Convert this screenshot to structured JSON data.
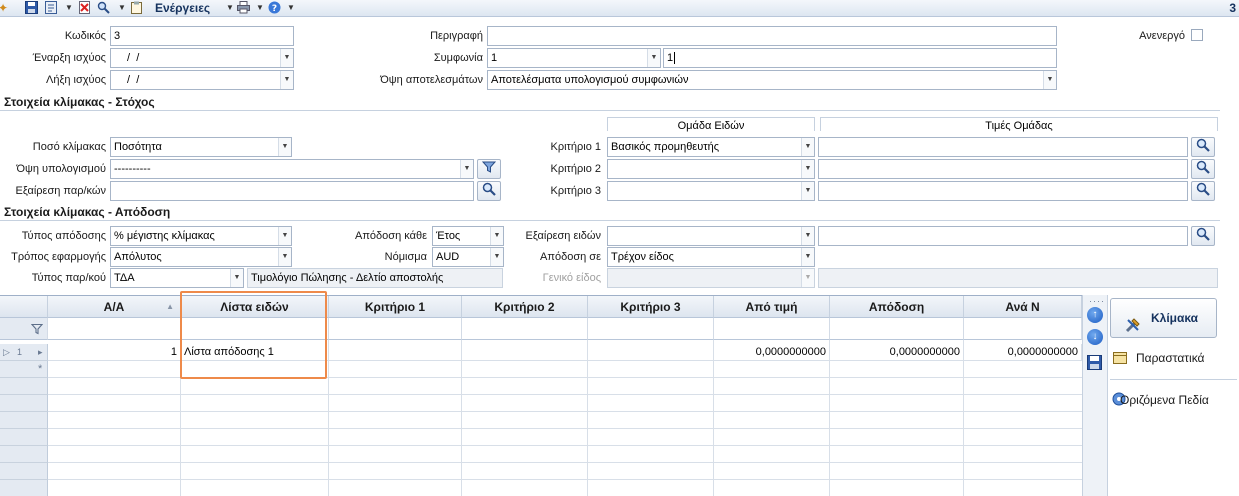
{
  "toolbar": {
    "actions_label": "Ενέργειες",
    "right_number": "3",
    "icons": [
      "new-icon",
      "save-icon",
      "save-as-icon",
      "delete-icon",
      "search-icon",
      "clipboard-icon",
      "print-icon",
      "help-icon"
    ]
  },
  "header": {
    "code_label": "Κωδικός",
    "code_value": "3",
    "start_label": "Έναρξη ισχύος",
    "start_value": " /  /",
    "end_label": "Λήξη ισχύος",
    "end_value": " /  /",
    "description_label": "Περιγραφή",
    "description_value": "",
    "agreement_label": "Συμφωνία",
    "agreement_value": "1",
    "agreement_name": "1",
    "results_view_label": "Όψη αποτελεσμάτων",
    "results_view_value": "Αποτελέσματα υπολογισμού συμφωνιών",
    "inactive_label": "Ανενεργό"
  },
  "target_section": {
    "title": "Στοιχεία κλίμακας - Στόχος",
    "group_header_left": "Ομάδα Ειδών",
    "group_header_right": "Τιμές Ομάδας",
    "scale_qty_label": "Ποσό κλίμακας",
    "scale_qty_value": "Ποσότητα",
    "calc_view_label": "Όψη υπολογισμού",
    "calc_view_value": "----------",
    "partner_excl_label": "Εξαίρεση παρ/κών",
    "partner_excl_value": "",
    "criteria": [
      {
        "label": "Κριτήριο 1",
        "value": "Βασικός προμηθευτής",
        "group_value": ""
      },
      {
        "label": "Κριτήριο 2",
        "value": "",
        "group_value": ""
      },
      {
        "label": "Κριτήριο 3",
        "value": "",
        "group_value": ""
      }
    ]
  },
  "yield_section": {
    "title": "Στοιχεία κλίμακας - Απόδοση",
    "yield_type_label": "Τύπος απόδοσης",
    "yield_type_value": "% μέγιστης κλίμακας",
    "apply_mode_label": "Τρόπος εφαρμογής",
    "apply_mode_value": "Απόλυτος",
    "partner_type_label": "Τύπος παρ/κού",
    "partner_type_code": "ΤΔΑ",
    "partner_type_desc": "Τιμολόγιο Πώλησης - Δελτίο αποστολής",
    "yield_every_label": "Απόδοση κάθε",
    "yield_every_value": "Έτος",
    "currency_label": "Νόμισμα",
    "currency_value": "AUD",
    "item_excl_label": "Εξαίρεση ειδών",
    "item_excl_value": "",
    "item_excl_extra": "",
    "yield_to_label": "Απόδοση σε",
    "yield_to_value": "Τρέχον είδος",
    "generic_item_label": "Γενικό είδος",
    "generic_item_value": ""
  },
  "grid": {
    "columns": [
      "Α/Α",
      "Λίστα ειδών",
      "Κριτήριο 1",
      "Κριτήριο 2",
      "Κριτήριο 3",
      "Από τιμή",
      "Απόδοση",
      "Ανά Ν"
    ],
    "rows": [
      {
        "row_no": "1",
        "aa": "1",
        "list": "Λίστα απόδοσης 1",
        "c1": "",
        "c2": "",
        "c3": "",
        "from": "0,0000000000",
        "yield": "0,0000000000",
        "per": "0,0000000000"
      }
    ],
    "new_row_marker": "*"
  },
  "side": {
    "scale_button": "Κλίμακα",
    "documents_link": "Παραστατικά",
    "custom_fields_link": "Οριζόμενα Πεδία"
  },
  "colors": {
    "accent": "#15325e",
    "highlight_border": "#ee8a4a",
    "header_gradient_top": "#f3f6fa"
  }
}
